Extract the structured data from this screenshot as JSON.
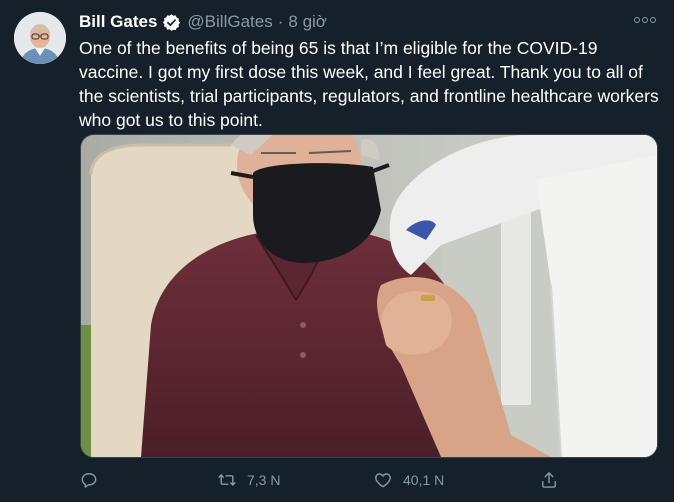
{
  "tweet": {
    "author": {
      "display_name": "Bill Gates",
      "handle": "@BillGates",
      "verified": true
    },
    "separator": "·",
    "timestamp": "8 giờ",
    "text": "One of the benefits of being 65 is that I’m eligible for the COVID-19 vaccine. I got my first dose this week, and I feel great. Thank you to all of the scientists, trial participants, regulators, and frontline healthcare workers who got us to this point.",
    "actions": {
      "reply": {
        "icon": "reply-icon",
        "count": ""
      },
      "retweet": {
        "icon": "retweet-icon",
        "count": "7,3 N"
      },
      "like": {
        "icon": "heart-icon",
        "count": "40,1 N"
      },
      "share": {
        "icon": "share-icon",
        "count": ""
      }
    }
  },
  "colors": {
    "background": "#15202b",
    "text_primary": "#ffffff",
    "text_secondary": "#8899a6",
    "verified_badge": "#ffffff"
  }
}
